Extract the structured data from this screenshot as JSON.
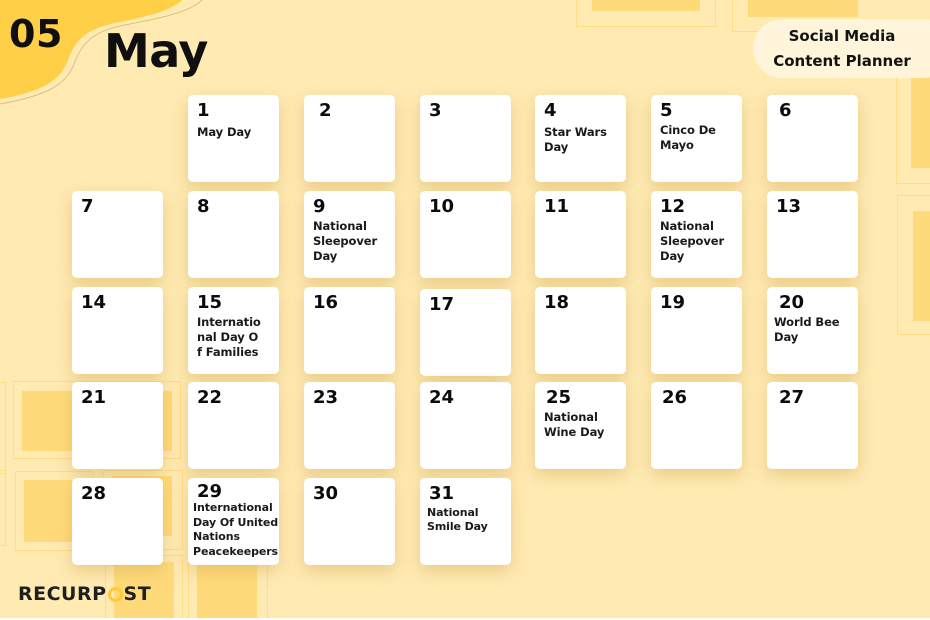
{
  "header": {
    "month_number": "05",
    "month_name": "May",
    "planner_title_line1": "Social Media",
    "planner_title_line2": "Content Planner"
  },
  "colors": {
    "background": "#FFEAB2",
    "accent_yellow": "#FFCF47",
    "accent_square": "#FFDA7A",
    "card": "#FFFFFF",
    "text": "#0F0F0F"
  },
  "calendar": {
    "days": [
      {
        "day": "1",
        "event": "May Day"
      },
      {
        "day": "2",
        "event": ""
      },
      {
        "day": "3",
        "event": ""
      },
      {
        "day": "4",
        "event": "Star Wars Day"
      },
      {
        "day": "5",
        "event": "Cinco De Mayo"
      },
      {
        "day": "6",
        "event": ""
      },
      {
        "day": "7",
        "event": ""
      },
      {
        "day": "8",
        "event": ""
      },
      {
        "day": "9",
        "event": "National Sleepover Day"
      },
      {
        "day": "10",
        "event": ""
      },
      {
        "day": "11",
        "event": ""
      },
      {
        "day": "12",
        "event": "National Sleepover Day"
      },
      {
        "day": "13",
        "event": ""
      },
      {
        "day": "14",
        "event": ""
      },
      {
        "day": "15",
        "event": "International Day Of Families"
      },
      {
        "day": "16",
        "event": ""
      },
      {
        "day": "17",
        "event": ""
      },
      {
        "day": "18",
        "event": ""
      },
      {
        "day": "19",
        "event": ""
      },
      {
        "day": "20",
        "event": "World Bee Day"
      },
      {
        "day": "21",
        "event": ""
      },
      {
        "day": "22",
        "event": ""
      },
      {
        "day": "23",
        "event": ""
      },
      {
        "day": "24",
        "event": ""
      },
      {
        "day": "25",
        "event": "National Wine Day"
      },
      {
        "day": "26",
        "event": ""
      },
      {
        "day": "27",
        "event": ""
      },
      {
        "day": "28",
        "event": ""
      },
      {
        "day": "29",
        "event": "International Day Of United Nations Peacekeepers"
      },
      {
        "day": "30",
        "event": ""
      },
      {
        "day": "31",
        "event": "National Smile Day"
      }
    ]
  },
  "footer": {
    "logo_text_before": "RECURP",
    "logo_text_after": "ST",
    "logo_icon": "clock-o-icon"
  }
}
